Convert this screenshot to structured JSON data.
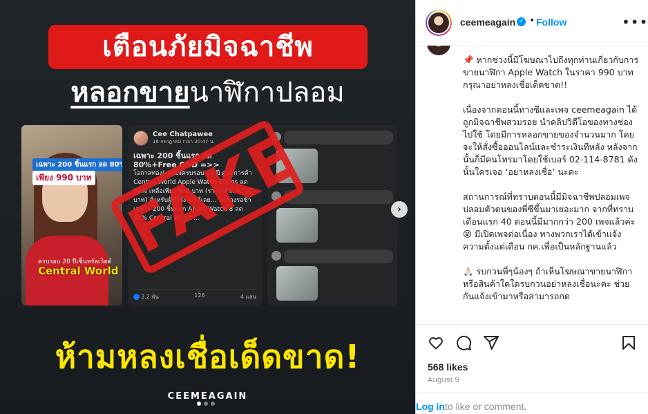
{
  "post_image": {
    "headline_line1": "เตือนภัยมิจฉาชีพ",
    "headline_line2_underlined": "หลอกขาย",
    "headline_line2_rest": "นาฬิกาปลอม",
    "stamp_text": "FAKE",
    "bottom_text": "ห้ามหลงเชื่อเด็ดขาด!",
    "brand": "CEEMEAGAIN",
    "photo_panel": {
      "promo_tag": "เฉพาะ 200 ชิ้นแรก ลด 80%",
      "price": "เพียง 990 บาท",
      "small_text": "ครบรอบ 20 ปีเซ็นทรัลเวิลด์",
      "location": "Central World"
    },
    "fb_panel": {
      "name": "Cee Chatpawee",
      "date": "16 กรกฎาคม เวลา 20:47 น.",
      "headline": "เฉพาะ 200 ชิ้นแรก ลด 80%+Free COD =>>",
      "body": "โอกาสทอง! ฉลองครบรอบ 20 ปี ศูนย์การค้า Central World Apple Watch Series ลด 80% เหลือเพียง 990 บาท (ราคาปกติ 4,950 บาท) สำหรับผู้ที่ใช้งานได้เลย... ไม่ต้องรอช้า เฉพาะ 200 ชิ้นแรก Apple Watch 8 ลด 80% Central World ...",
      "likes": "3.2 พัน",
      "comments": "126",
      "shares": "4 แสน"
    },
    "carousel_dots": 3,
    "active_dot": 1
  },
  "sidebar": {
    "username": "ceemeagain",
    "verified": true,
    "follow_label": "Follow",
    "more_label": "•••",
    "caption": "📌 หากช่วงนี้มีโฆษณาไปถึงทุกท่านเกี่ยวกับการขายนาฬิกา Apple Watch ในราคา 990 บาท กรุณาอย่าหลงเชื่อเด็ดขาด!!\n\nเนื่องจากตอนนี้ทางซีและเพจ ceemeagain ได้ถูกมิจฉาชีพสวมรอย นำคลิปวิดีโอของทางช่องไปใช้ โดยมีการหลอกขายของจำนวนมาก โดยจะให้สั่งซื้อออนไลน์และชำระเงินทีหลัง หลังจากนั้นก็มีคนโทรมาโดยใช้เบอร์ 02-114-8781 ดังนั้นใครเจอ ‘อย่าหลงเชื่อ’ นะคะ\n\nสถานการณ์ที่ทราบตอนนี้มีมิจฉาชีพปลอมเพจ ปลอมตัวตนของพี่ซีขึ้นมาเยอะมาก จากที่ทราบเดือนแรก 40 ตอนนี้มีมากกว่า 200 เพจแล้วค่ะ 😵 มีเปิดเพจต่อเนื่อง ทางพวกเราได้เข้าแจ้งความตั้งแต่เดือน กค.เพื่อเป็นหลักฐานแล้ว\n\n🙏🏻 รบกวนพี่ๆน้องๆ ถ้าเห็นโฆษณาขายนาฬิกาหรือสินค้าใดใดรบกวนอย่าหลงเชื่อนะคะ ช่วยกันแจ้งเข้ามาหรือสามารถกด",
    "likes": "568 likes",
    "date": "August 9",
    "login_link": "Log in",
    "login_rest": "to like or comment."
  },
  "colors": {
    "accent_blue": "#0095f6",
    "banner_red": "#e01919",
    "bottom_yellow": "#ffe600"
  }
}
